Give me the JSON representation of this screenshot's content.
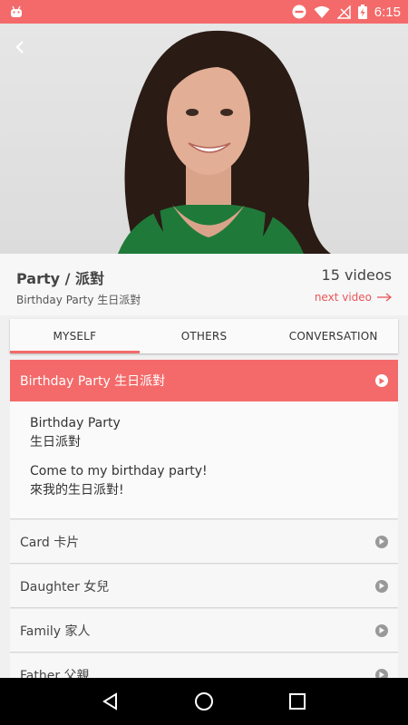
{
  "status_bar": {
    "time": "6:15",
    "color": "#f46a6a",
    "icons": [
      "android-icon",
      "do-not-disturb-icon",
      "wifi-icon",
      "no-signal-icon",
      "battery-charging-icon"
    ]
  },
  "video": {
    "back_icon": "chevron-left-icon"
  },
  "header": {
    "lesson_title": "Party / 派對",
    "video_count": "15 videos",
    "current_title": "Birthday Party 生日派對",
    "next_label": "next video"
  },
  "tabs": [
    {
      "label": "MYSELF",
      "active": true
    },
    {
      "label": "OTHERS",
      "active": false
    },
    {
      "label": "CONVERSATION",
      "active": false
    }
  ],
  "list": {
    "active": {
      "label": "Birthday Party  生日派對",
      "detail": {
        "word_en": "Birthday Party",
        "word_zh": "生日派對",
        "sentence_en": "Come to my birthday party!",
        "sentence_zh": "來我的生日派對!"
      }
    },
    "items": [
      {
        "label": "Card  卡片"
      },
      {
        "label": "Daughter  女兒"
      },
      {
        "label": "Family  家人"
      },
      {
        "label": "Father  父親"
      }
    ]
  },
  "accent_color": "#f46a6a"
}
